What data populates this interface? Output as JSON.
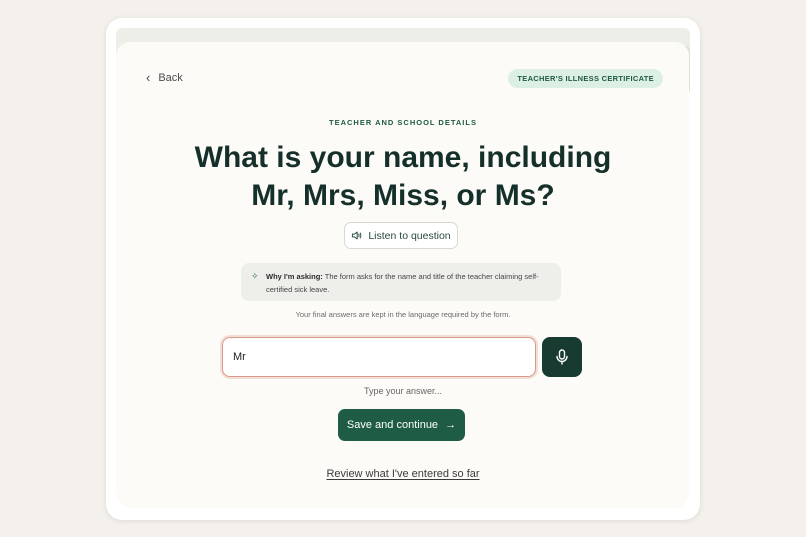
{
  "nav": {
    "back_label": "Back"
  },
  "form": {
    "badge": "TEACHER'S ILLNESS CERTIFICATE"
  },
  "section": {
    "label": "TEACHER AND SCHOOL DETAILS"
  },
  "question": {
    "line1": "What is your name, including",
    "line2": "Mr, Mrs, Miss, or Ms?",
    "listen_label": "Listen to question"
  },
  "why": {
    "label": "Why I'm asking:",
    "text": "The form asks for the name and title of the teacher claiming self-certified sick leave."
  },
  "note": "Your final answers are kept in the language required by the form.",
  "answer": {
    "value": "Mr",
    "hint": "Type your answer..."
  },
  "actions": {
    "save_label": "Save and continue",
    "review_label": "Review what I've entered so far"
  },
  "icons": {
    "back": "chevron-left-icon",
    "listen": "speaker-icon",
    "why": "sparkle-icon",
    "mic": "microphone-icon",
    "save": "arrow-right-icon"
  },
  "colors": {
    "accent": "#1f5c45",
    "badge_bg": "#dcefe4",
    "input_border": "#d89a88",
    "mic_bg": "#173a31"
  }
}
